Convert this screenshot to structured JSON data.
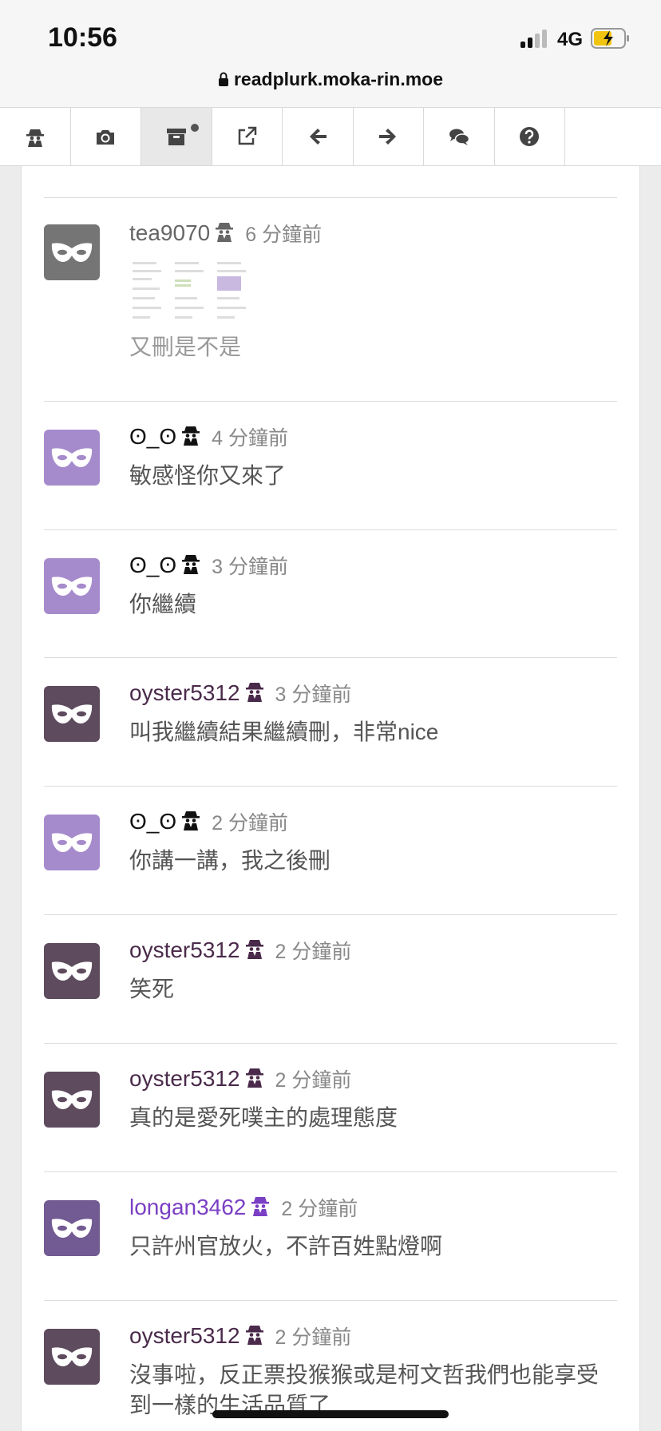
{
  "status_bar": {
    "time": "10:56",
    "network": "4G"
  },
  "address_bar": {
    "url": "readplurk.moka-rin.moe"
  },
  "toolbar": {
    "buttons": [
      {
        "name": "anonymous-icon"
      },
      {
        "name": "camera-icon"
      },
      {
        "name": "archive-icon",
        "active": true
      },
      {
        "name": "external-link-icon"
      },
      {
        "name": "arrow-left-icon"
      },
      {
        "name": "arrow-right-icon"
      },
      {
        "name": "comments-icon"
      },
      {
        "name": "help-icon"
      }
    ]
  },
  "responses": [
    {
      "user": "tea9070",
      "time": "6 分鐘前",
      "text": "又刪是不是",
      "user_color": "#666666",
      "avatar_color": "#757575",
      "has_images": true
    },
    {
      "user": "ʘ_ʘ",
      "time": "4 分鐘前",
      "text": "敏感怪你又來了",
      "user_color": "#111111",
      "avatar_color": "#a68bcc"
    },
    {
      "user": "ʘ_ʘ",
      "time": "3 分鐘前",
      "text": "你繼續",
      "user_color": "#111111",
      "avatar_color": "#a68bcc"
    },
    {
      "user": "oyster5312",
      "time": "3 分鐘前",
      "text": "叫我繼續結果繼續刪，非常nice",
      "user_color": "#4a2a4a",
      "avatar_color": "#5e4b5e"
    },
    {
      "user": "ʘ_ʘ",
      "time": "2 分鐘前",
      "text": "你講一講，我之後刪",
      "user_color": "#111111",
      "avatar_color": "#a68bcc"
    },
    {
      "user": "oyster5312",
      "time": "2 分鐘前",
      "text": "笑死",
      "user_color": "#4a2a4a",
      "avatar_color": "#5e4b5e"
    },
    {
      "user": "oyster5312",
      "time": "2 分鐘前",
      "text": "真的是愛死噗主的處理態度",
      "user_color": "#4a2a4a",
      "avatar_color": "#5e4b5e"
    },
    {
      "user": "longan3462",
      "time": "2 分鐘前",
      "text": "只許州官放火，不許百姓點燈啊",
      "user_color": "#7b3fc4",
      "avatar_color": "#725a92"
    },
    {
      "user": "oyster5312",
      "time": "2 分鐘前",
      "text": "沒事啦，反正票投猴猴或是柯文哲我們也能享受到一樣的生活品質了",
      "user_color": "#4a2a4a",
      "avatar_color": "#5e4b5e"
    }
  ]
}
